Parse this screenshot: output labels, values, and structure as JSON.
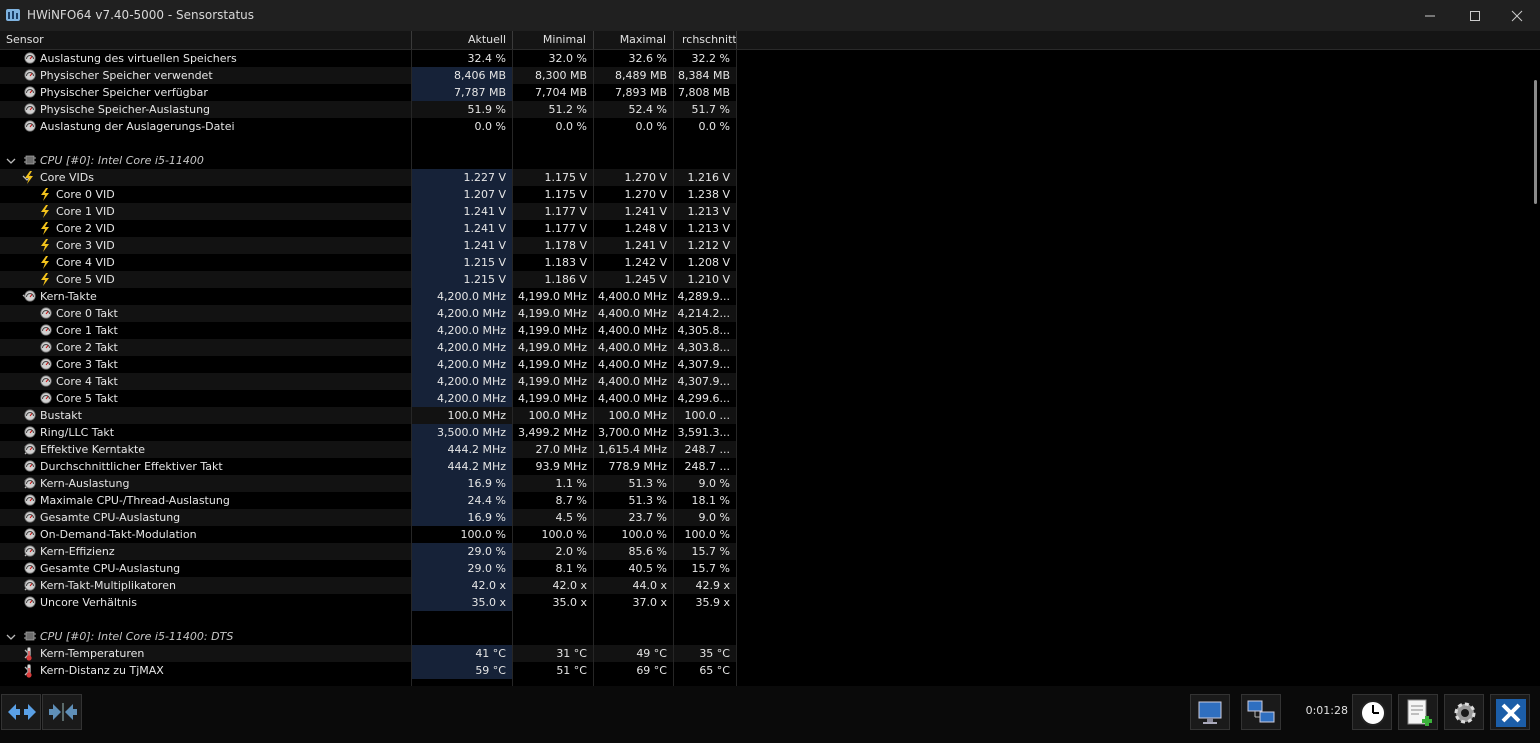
{
  "window": {
    "title": "HWiNFO64 v7.40-5000 - Sensorstatus"
  },
  "columns": {
    "sensor": "Sensor",
    "current": "Aktuell",
    "min": "Minimal",
    "max": "Maximal",
    "avg": "rchschnitt"
  },
  "rows": [
    {
      "type": "sensor",
      "level": 1,
      "icon": "gauge-icon",
      "name": "Auslastung des virtuellen Speichers",
      "cur": "32.4 %",
      "min": "32.0 %",
      "max": "32.6 %",
      "avg": "32.2 %",
      "hl": false
    },
    {
      "type": "sensor",
      "level": 1,
      "icon": "gauge-icon",
      "name": "Physischer Speicher verwendet",
      "cur": "8,406 MB",
      "min": "8,300 MB",
      "max": "8,489 MB",
      "avg": "8,384 MB",
      "hl": true
    },
    {
      "type": "sensor",
      "level": 1,
      "icon": "gauge-icon",
      "name": "Physischer Speicher verfügbar",
      "cur": "7,787 MB",
      "min": "7,704 MB",
      "max": "7,893 MB",
      "avg": "7,808 MB",
      "hl": true
    },
    {
      "type": "sensor",
      "level": 1,
      "icon": "gauge-icon",
      "name": "Physische Speicher-Auslastung",
      "cur": "51.9 %",
      "min": "51.2 %",
      "max": "52.4 %",
      "avg": "51.7 %",
      "hl": false
    },
    {
      "type": "sensor",
      "level": 1,
      "icon": "gauge-icon",
      "name": "Auslastung der Auslagerungs-Datei",
      "cur": "0.0 %",
      "min": "0.0 %",
      "max": "0.0 %",
      "avg": "0.0 %",
      "hl": false
    },
    {
      "type": "blank"
    },
    {
      "type": "group",
      "level": 0,
      "icon": "chip-icon",
      "expander": "v",
      "name": "CPU [#0]: Intel Core i5-11400"
    },
    {
      "type": "sensor",
      "level": 1,
      "icon": "bolt-icon",
      "expander": "v",
      "name": "Core VIDs",
      "cur": "1.227 V",
      "min": "1.175 V",
      "max": "1.270 V",
      "avg": "1.216 V",
      "hl": true
    },
    {
      "type": "sensor",
      "level": 2,
      "icon": "bolt-icon",
      "name": "Core 0 VID",
      "cur": "1.207 V",
      "min": "1.175 V",
      "max": "1.270 V",
      "avg": "1.238 V",
      "hl": true
    },
    {
      "type": "sensor",
      "level": 2,
      "icon": "bolt-icon",
      "name": "Core 1 VID",
      "cur": "1.241 V",
      "min": "1.177 V",
      "max": "1.241 V",
      "avg": "1.213 V",
      "hl": true
    },
    {
      "type": "sensor",
      "level": 2,
      "icon": "bolt-icon",
      "name": "Core 2 VID",
      "cur": "1.241 V",
      "min": "1.177 V",
      "max": "1.248 V",
      "avg": "1.213 V",
      "hl": true
    },
    {
      "type": "sensor",
      "level": 2,
      "icon": "bolt-icon",
      "name": "Core 3 VID",
      "cur": "1.241 V",
      "min": "1.178 V",
      "max": "1.241 V",
      "avg": "1.212 V",
      "hl": true
    },
    {
      "type": "sensor",
      "level": 2,
      "icon": "bolt-icon",
      "name": "Core 4 VID",
      "cur": "1.215 V",
      "min": "1.183 V",
      "max": "1.242 V",
      "avg": "1.208 V",
      "hl": true
    },
    {
      "type": "sensor",
      "level": 2,
      "icon": "bolt-icon",
      "name": "Core 5 VID",
      "cur": "1.215 V",
      "min": "1.186 V",
      "max": "1.245 V",
      "avg": "1.210 V",
      "hl": true
    },
    {
      "type": "sensor",
      "level": 1,
      "icon": "gauge-icon",
      "expander": "v",
      "name": "Kern-Takte",
      "cur": "4,200.0 MHz",
      "min": "4,199.0 MHz",
      "max": "4,400.0 MHz",
      "avg": "4,289.9...",
      "hl": true
    },
    {
      "type": "sensor",
      "level": 2,
      "icon": "gauge-icon",
      "name": "Core 0 Takt",
      "cur": "4,200.0 MHz",
      "min": "4,199.0 MHz",
      "max": "4,400.0 MHz",
      "avg": "4,214.2...",
      "hl": true
    },
    {
      "type": "sensor",
      "level": 2,
      "icon": "gauge-icon",
      "name": "Core 1 Takt",
      "cur": "4,200.0 MHz",
      "min": "4,199.0 MHz",
      "max": "4,400.0 MHz",
      "avg": "4,305.8...",
      "hl": true
    },
    {
      "type": "sensor",
      "level": 2,
      "icon": "gauge-icon",
      "name": "Core 2 Takt",
      "cur": "4,200.0 MHz",
      "min": "4,199.0 MHz",
      "max": "4,400.0 MHz",
      "avg": "4,303.8...",
      "hl": true
    },
    {
      "type": "sensor",
      "level": 2,
      "icon": "gauge-icon",
      "name": "Core 3 Takt",
      "cur": "4,200.0 MHz",
      "min": "4,199.0 MHz",
      "max": "4,400.0 MHz",
      "avg": "4,307.9...",
      "hl": true
    },
    {
      "type": "sensor",
      "level": 2,
      "icon": "gauge-icon",
      "name": "Core 4 Takt",
      "cur": "4,200.0 MHz",
      "min": "4,199.0 MHz",
      "max": "4,400.0 MHz",
      "avg": "4,307.9...",
      "hl": true
    },
    {
      "type": "sensor",
      "level": 2,
      "icon": "gauge-icon",
      "name": "Core 5 Takt",
      "cur": "4,200.0 MHz",
      "min": "4,199.0 MHz",
      "max": "4,400.0 MHz",
      "avg": "4,299.6...",
      "hl": true
    },
    {
      "type": "sensor",
      "level": 1,
      "icon": "gauge-icon",
      "name": "Bustakt",
      "cur": "100.0 MHz",
      "min": "100.0 MHz",
      "max": "100.0 MHz",
      "avg": "100.0 ...",
      "hl": false
    },
    {
      "type": "sensor",
      "level": 1,
      "icon": "gauge-icon",
      "name": "Ring/LLC Takt",
      "cur": "3,500.0 MHz",
      "min": "3,499.2 MHz",
      "max": "3,700.0 MHz",
      "avg": "3,591.3...",
      "hl": true
    },
    {
      "type": "sensor",
      "level": 1,
      "icon": "gauge-icon",
      "expander": ">",
      "name": "Effektive Kerntakte",
      "cur": "444.2 MHz",
      "min": "27.0 MHz",
      "max": "1,615.4 MHz",
      "avg": "248.7 ...",
      "hl": true
    },
    {
      "type": "sensor",
      "level": 1,
      "icon": "gauge-icon",
      "name": "Durchschnittlicher Effektiver Takt",
      "cur": "444.2 MHz",
      "min": "93.9 MHz",
      "max": "778.9 MHz",
      "avg": "248.7 ...",
      "hl": true
    },
    {
      "type": "sensor",
      "level": 1,
      "icon": "gauge-icon",
      "expander": ">",
      "name": "Kern-Auslastung",
      "cur": "16.9 %",
      "min": "1.1 %",
      "max": "51.3 %",
      "avg": "9.0 %",
      "hl": true
    },
    {
      "type": "sensor",
      "level": 1,
      "icon": "gauge-icon",
      "name": "Maximale CPU-/Thread-Auslastung",
      "cur": "24.4 %",
      "min": "8.7 %",
      "max": "51.3 %",
      "avg": "18.1 %",
      "hl": true
    },
    {
      "type": "sensor",
      "level": 1,
      "icon": "gauge-icon",
      "name": "Gesamte CPU-Auslastung",
      "cur": "16.9 %",
      "min": "4.5 %",
      "max": "23.7 %",
      "avg": "9.0 %",
      "hl": true
    },
    {
      "type": "sensor",
      "level": 1,
      "icon": "gauge-icon",
      "name": "On-Demand-Takt-Modulation",
      "cur": "100.0 %",
      "min": "100.0 %",
      "max": "100.0 %",
      "avg": "100.0 %",
      "hl": false
    },
    {
      "type": "sensor",
      "level": 1,
      "icon": "gauge-icon",
      "expander": ">",
      "name": "Kern-Effizienz",
      "cur": "29.0 %",
      "min": "2.0 %",
      "max": "85.6 %",
      "avg": "15.7 %",
      "hl": true
    },
    {
      "type": "sensor",
      "level": 1,
      "icon": "gauge-icon",
      "name": "Gesamte CPU-Auslastung",
      "cur": "29.0 %",
      "min": "8.1 %",
      "max": "40.5 %",
      "avg": "15.7 %",
      "hl": true
    },
    {
      "type": "sensor",
      "level": 1,
      "icon": "gauge-icon",
      "expander": ">",
      "name": "Kern-Takt-Multiplikatoren",
      "cur": "42.0 x",
      "min": "42.0 x",
      "max": "44.0 x",
      "avg": "42.9 x",
      "hl": true
    },
    {
      "type": "sensor",
      "level": 1,
      "icon": "gauge-icon",
      "name": "Uncore Verhältnis",
      "cur": "35.0 x",
      "min": "35.0 x",
      "max": "37.0 x",
      "avg": "35.9 x",
      "hl": true
    },
    {
      "type": "blank"
    },
    {
      "type": "group",
      "level": 0,
      "icon": "chip-icon",
      "expander": "v",
      "name": "CPU [#0]: Intel Core i5-11400: DTS"
    },
    {
      "type": "sensor",
      "level": 1,
      "icon": "thermometer-icon",
      "expander": ">",
      "name": "Kern-Temperaturen",
      "cur": "41 °C",
      "min": "31 °C",
      "max": "49 °C",
      "avg": "35 °C",
      "hl": true
    },
    {
      "type": "sensor",
      "level": 1,
      "icon": "thermometer-icon",
      "expander": ">",
      "name": "Kern-Distanz zu TjMAX",
      "cur": "59 °C",
      "min": "51 °C",
      "max": "69 °C",
      "avg": "65 °C",
      "hl": true
    }
  ],
  "toolbar": {
    "elapsed": "0:01:28"
  }
}
